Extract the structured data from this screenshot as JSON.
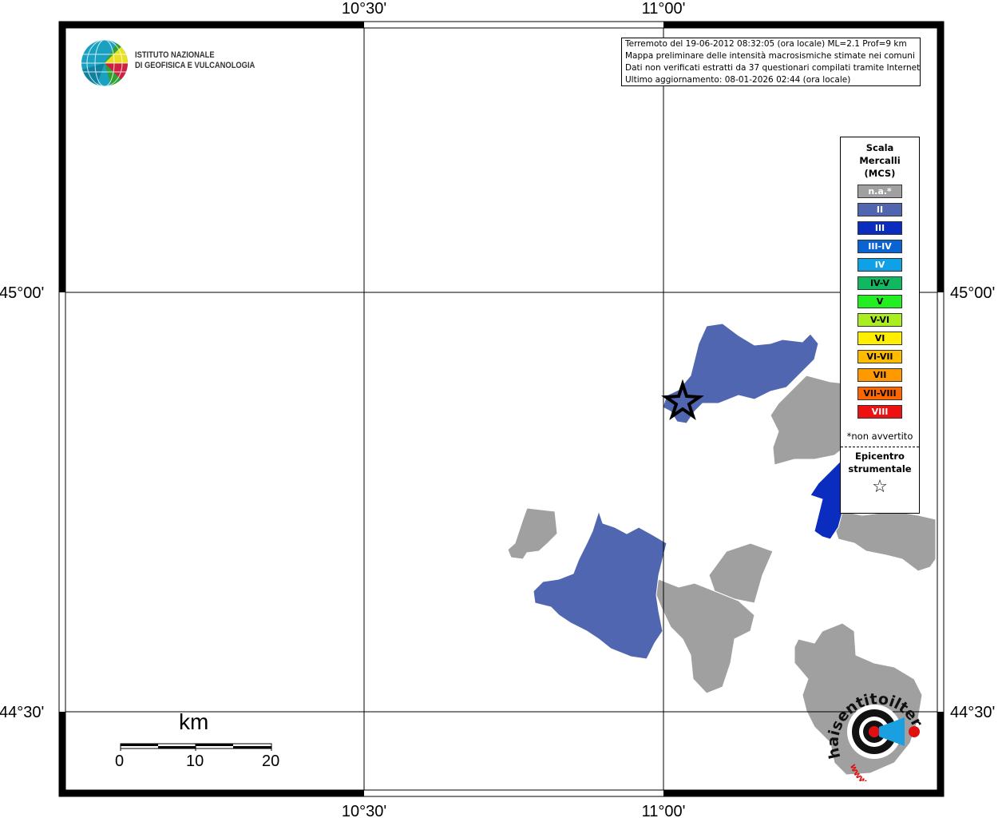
{
  "map": {
    "x_ticks": [
      "10°30'",
      "11°00'"
    ],
    "y_ticks": [
      "45°00'",
      "44°30'"
    ]
  },
  "logo": {
    "line1": "ISTITUTO NAZIONALE",
    "line2": "DI GEOFISICA E VULCANOLOGIA"
  },
  "info": {
    "line1": "Terremoto del 19-06-2012 08:32:05 (ora locale) ML=2.1 Prof=9 km",
    "line2": "Mappa preliminare delle intensità macrosismiche stimate nei comuni",
    "line3": "Dati non verificati estratti da 37 questionari compilati tramite Internet.",
    "line4": "Ultimo aggiornamento: 08-01-2026 02:44 (ora locale)"
  },
  "legend": {
    "title1": "Scala",
    "title2": "Mercalli",
    "title3": "(MCS)",
    "items": [
      {
        "label": "n.a.*",
        "color": "#a0a0a0"
      },
      {
        "label": "II",
        "color": "#5066b0"
      },
      {
        "label": "III",
        "color": "#0a2dbf"
      },
      {
        "label": "III-IV",
        "color": "#0a63d2"
      },
      {
        "label": "IV",
        "color": "#10a0e6"
      },
      {
        "label": "IV-V",
        "color": "#10b860"
      },
      {
        "label": "V",
        "color": "#22ee22"
      },
      {
        "label": "V-VI",
        "color": "#aaee22"
      },
      {
        "label": "VI",
        "color": "#ffee00"
      },
      {
        "label": "VI-VII",
        "color": "#ffbb00"
      },
      {
        "label": "VII",
        "color": "#ff9900"
      },
      {
        "label": "VII-VIII",
        "color": "#ff6600"
      },
      {
        "label": "VIII",
        "color": "#ee1111"
      }
    ],
    "note": "*non avvertito",
    "epi1": "Epicentro",
    "epi2": "strumentale",
    "star": "☆"
  },
  "scale": {
    "title": "km",
    "labels": [
      "0",
      "10",
      "20"
    ]
  },
  "watermark": {
    "text": "haisentitoilterremoto.it",
    "url": "www."
  }
}
